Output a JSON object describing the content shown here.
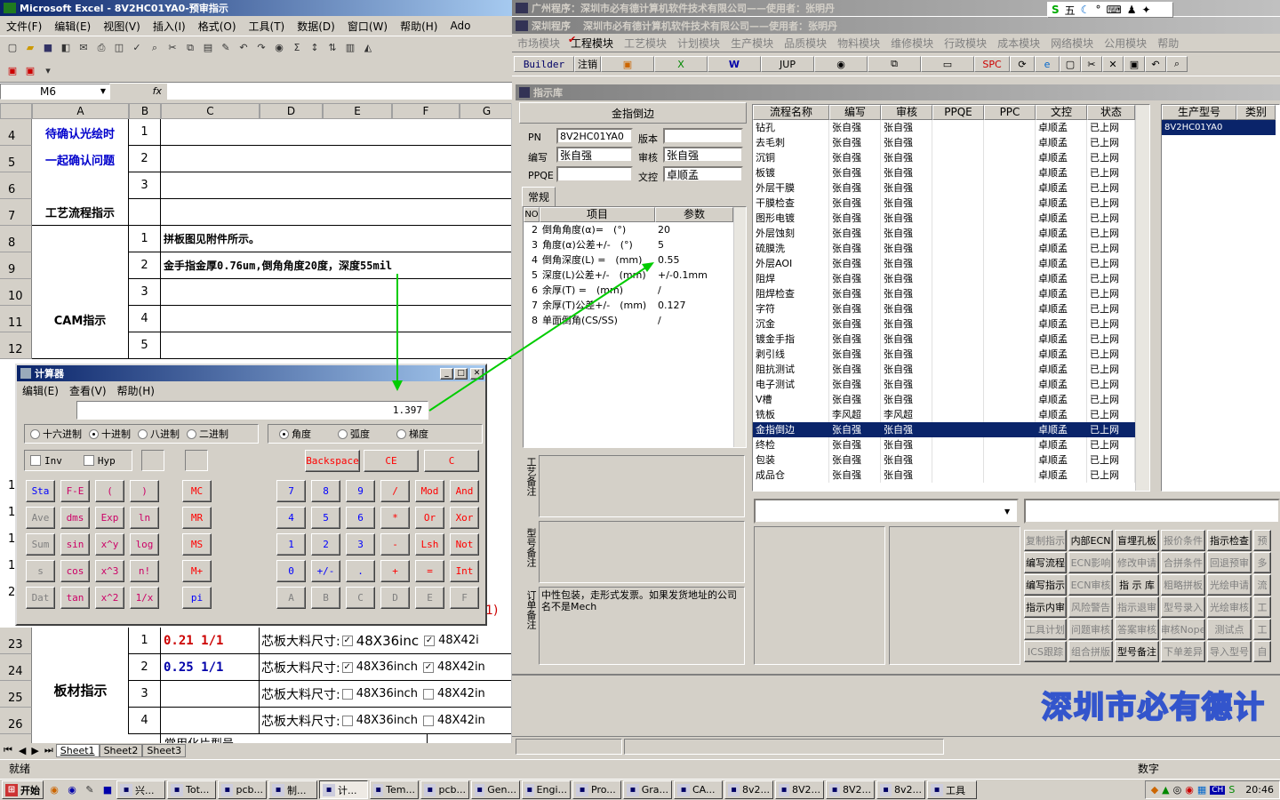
{
  "excel": {
    "title": "Microsoft Excel - 8V2HC01YA0-预审指示",
    "menu": [
      "文件(F)",
      "编辑(E)",
      "视图(V)",
      "插入(I)",
      "格式(O)",
      "工具(T)",
      "数据(D)",
      "窗口(W)",
      "帮助(H)",
      "Ado"
    ],
    "namebox": "M6",
    "fx": "fx",
    "columns": [
      "A",
      "B",
      "C",
      "D",
      "E",
      "F",
      "G"
    ],
    "rows_top": [
      {
        "n": "4",
        "a": "待确认光绘时",
        "b": "1",
        "c": ""
      },
      {
        "n": "5",
        "a": "一起确认问题",
        "b": "2",
        "c": ""
      },
      {
        "n": "6",
        "a": "",
        "b": "3",
        "c": ""
      },
      {
        "n": "7",
        "a": "工艺流程指示",
        "b": "",
        "c": ""
      },
      {
        "n": "8",
        "a": "",
        "b": "1",
        "c": "拼板图见附件所示。"
      },
      {
        "n": "9",
        "a": "",
        "b": "2",
        "c": "金手指金厚0.76um,倒角角度20度，深度55mil"
      },
      {
        "n": "10",
        "a": "",
        "b": "3",
        "c": ""
      },
      {
        "n": "11",
        "a": "CAM指示",
        "b": "4",
        "c": ""
      },
      {
        "n": "12",
        "a": "",
        "b": "5",
        "c": ""
      }
    ],
    "side_row_nums": [
      "1",
      "1",
      "1",
      "1",
      "2"
    ],
    "side_text": "1)",
    "rows_bottom": [
      {
        "n": "23",
        "b": "1",
        "c": "0.21 1/1",
        "d": "芯板大料尺寸:",
        "e": "48X36inc",
        "f": "48X42i"
      },
      {
        "n": "24",
        "b": "2",
        "c": "0.25 1/1",
        "d": "芯板大料尺寸:",
        "e": "48X36inch",
        "f": "48X42in"
      },
      {
        "n": "25",
        "b": "3",
        "c": "",
        "d": "芯板大料尺寸:",
        "e": "48X36inch",
        "f": "48X42in"
      },
      {
        "n": "26",
        "b": "4",
        "c": "",
        "d": "芯板大料尺寸:",
        "e": "48X36inch",
        "f": "48X42in"
      }
    ],
    "cut_row": "常用化片型号",
    "banding_label": "板材指示",
    "sheets": [
      "Sheet1",
      "Sheet2",
      "Sheet3"
    ],
    "status": "就绪"
  },
  "erp": {
    "title": "广州程序：深圳市必有德计算机软件技术有限公司——使用者：张明丹",
    "title2": "深圳程序",
    "title2b": "深圳市必有德计算机软件技术有限公司——使用者：张明丹",
    "menu": [
      "市场模块",
      "工程模块",
      "工艺模块",
      "计划模块",
      "生产模块",
      "品质模块",
      "物料模块",
      "维修模块",
      "行政模块",
      "成本模块",
      "网络模块",
      "公用模块",
      "帮助"
    ],
    "toolbar": [
      "Builder",
      "注销",
      "JUP",
      "SPC"
    ],
    "panel_title": "指示库",
    "subtitle": "金指倒边",
    "form": {
      "pn_label": "PN",
      "pn": "8V2HC01YA0",
      "ver_label": "版本",
      "ver": "",
      "writer_label": "编写",
      "writer": "张自强",
      "audit_label": "审核",
      "audit": "张自强",
      "ppqe_label": "PPQE",
      "ppqe": "",
      "doc_label": "文控",
      "doc": "卓顺孟"
    },
    "tab": "常规",
    "params_headers": [
      "NO",
      "项目",
      "参数"
    ],
    "params": [
      {
        "no": "2",
        "item": "倒角角度(α)=　(°)",
        "val": "20"
      },
      {
        "no": "3",
        "item": "角度(α)公差+/-　(°)",
        "val": "5"
      },
      {
        "no": "4",
        "item": "倒角深度(L) =　(mm)",
        "val": "0.55"
      },
      {
        "no": "5",
        "item": "深度(L)公差+/-　(mm)",
        "val": "+/-0.1mm"
      },
      {
        "no": "6",
        "item": "余厚(T) =　(mm)",
        "val": "/"
      },
      {
        "no": "7",
        "item": "余厚(T)公差+/-　(mm)",
        "val": "0.127"
      },
      {
        "no": "8",
        "item": "单面倒角(CS/SS)",
        "val": "/"
      }
    ],
    "notes": {
      "craft": "工艺备注",
      "model": "型号备注",
      "order": "订单备注",
      "order_text": "中性包装，走形式发票。如果发货地址的公司名不是Mech"
    },
    "flow_headers": [
      "流程名称",
      "编写",
      "审核",
      "PPQE",
      "PPC",
      "文控",
      "状态"
    ],
    "flow": [
      [
        "钻孔",
        "张自强",
        "张自强",
        "",
        "",
        "卓顺孟",
        "已上网"
      ],
      [
        "去毛刺",
        "张自强",
        "张自强",
        "",
        "",
        "卓顺孟",
        "已上网"
      ],
      [
        "沉铜",
        "张自强",
        "张自强",
        "",
        "",
        "卓顺孟",
        "已上网"
      ],
      [
        "板镀",
        "张自强",
        "张自强",
        "",
        "",
        "卓顺孟",
        "已上网"
      ],
      [
        "外层干膜",
        "张自强",
        "张自强",
        "",
        "",
        "卓顺孟",
        "已上网"
      ],
      [
        "干膜检查",
        "张自强",
        "张自强",
        "",
        "",
        "卓顺孟",
        "已上网"
      ],
      [
        "图形电镀",
        "张自强",
        "张自强",
        "",
        "",
        "卓顺孟",
        "已上网"
      ],
      [
        "外层蚀刻",
        "张自强",
        "张自强",
        "",
        "",
        "卓顺孟",
        "已上网"
      ],
      [
        "硫膜洗",
        "张自强",
        "张自强",
        "",
        "",
        "卓顺孟",
        "已上网"
      ],
      [
        "外层AOI",
        "张自强",
        "张自强",
        "",
        "",
        "卓顺孟",
        "已上网"
      ],
      [
        "阻焊",
        "张自强",
        "张自强",
        "",
        "",
        "卓顺孟",
        "已上网"
      ],
      [
        "阻焊检查",
        "张自强",
        "张自强",
        "",
        "",
        "卓顺孟",
        "已上网"
      ],
      [
        "字符",
        "张自强",
        "张自强",
        "",
        "",
        "卓顺孟",
        "已上网"
      ],
      [
        "沉金",
        "张自强",
        "张自强",
        "",
        "",
        "卓顺孟",
        "已上网"
      ],
      [
        "镀金手指",
        "张自强",
        "张自强",
        "",
        "",
        "卓顺孟",
        "已上网"
      ],
      [
        "剥引线",
        "张自强",
        "张自强",
        "",
        "",
        "卓顺孟",
        "已上网"
      ],
      [
        "阻抗测试",
        "张自强",
        "张自强",
        "",
        "",
        "卓顺孟",
        "已上网"
      ],
      [
        "电子测试",
        "张自强",
        "张自强",
        "",
        "",
        "卓顺孟",
        "已上网"
      ],
      [
        "V槽",
        "张自强",
        "张自强",
        "",
        "",
        "卓顺孟",
        "已上网"
      ],
      [
        "铣板",
        "李风超",
        "李风超",
        "",
        "",
        "卓顺孟",
        "已上网"
      ],
      [
        "金指倒边",
        "张自强",
        "张自强",
        "",
        "",
        "卓顺孟",
        "已上网"
      ],
      [
        "终检",
        "张自强",
        "张自强",
        "",
        "",
        "卓顺孟",
        "已上网"
      ],
      [
        "包装",
        "张自强",
        "张自强",
        "",
        "",
        "卓顺孟",
        "已上网"
      ],
      [
        "成品仓",
        "张自强",
        "张自强",
        "",
        "",
        "卓顺孟",
        "已上网"
      ]
    ],
    "selected_flow": 20,
    "model_headers": [
      "生产型号",
      "类别"
    ],
    "model_rows": [
      [
        "8V2HC01YA0",
        ""
      ]
    ],
    "action_buttons": [
      [
        "复制指示",
        "内部ECN",
        "盲埋孔板",
        "报价条件",
        "指示检查",
        "预"
      ],
      [
        "编写流程",
        "ECN影响",
        "修改申请",
        "合拼条件",
        "回退预审",
        "多"
      ],
      [
        "编写指示",
        "ECN审核",
        "指 示 库",
        "粗略拼板",
        "光绘申请",
        "流"
      ],
      [
        "指示内审",
        "风险警告",
        "指示退审",
        "型号录入",
        "光绘审核",
        "工"
      ],
      [
        "工具计划",
        "问题审核",
        "答案审核",
        "审核Nope",
        "测试点",
        "工"
      ],
      [
        "ICS跟踪",
        "组合拼版",
        "型号备注",
        "下单差异",
        "导入型号",
        "自"
      ]
    ],
    "action_enabled": [
      [
        false,
        true,
        true,
        false,
        true,
        false
      ],
      [
        true,
        false,
        false,
        false,
        false,
        false
      ],
      [
        true,
        false,
        true,
        false,
        false,
        false
      ],
      [
        true,
        false,
        false,
        false,
        false,
        false
      ],
      [
        false,
        false,
        false,
        false,
        false,
        false
      ],
      [
        false,
        false,
        true,
        false,
        false,
        false
      ]
    ],
    "brand": "深圳市必有德计",
    "status_right": "数字"
  },
  "calc": {
    "title": "计算器",
    "menu": [
      "编辑(E)",
      "查看(V)",
      "帮助(H)"
    ],
    "display": "1.397",
    "bases": [
      "十六进制",
      "十进制",
      "八进制",
      "二进制"
    ],
    "base_selected": 1,
    "angles": [
      "角度",
      "弧度",
      "梯度"
    ],
    "angle_selected": 0,
    "inv": "Inv",
    "hyp": "Hyp",
    "backspace": "Backspace",
    "ce": "CE",
    "c": "C",
    "sci": [
      [
        "Sta",
        "F-E",
        "(",
        ")"
      ],
      [
        "Ave",
        "dms",
        "Exp",
        "ln"
      ],
      [
        "Sum",
        "sin",
        "x^y",
        "log"
      ],
      [
        "s",
        "cos",
        "x^3",
        "n!"
      ],
      [
        "Dat",
        "tan",
        "x^2",
        "1/x"
      ]
    ],
    "mem": [
      "MC",
      "MR",
      "MS",
      "M+",
      "pi"
    ],
    "num": [
      [
        "7",
        "8",
        "9",
        "/",
        "Mod",
        "And"
      ],
      [
        "4",
        "5",
        "6",
        "*",
        "Or",
        "Xor"
      ],
      [
        "1",
        "2",
        "3",
        "-",
        "Lsh",
        "Not"
      ],
      [
        "0",
        "+/-",
        ".",
        "+",
        "=",
        "Int"
      ],
      [
        "A",
        "B",
        "C",
        "D",
        "E",
        "F"
      ]
    ]
  },
  "taskbar": {
    "start": "开始",
    "tasks": [
      "兴...",
      "Tot...",
      "pcb...",
      "制...",
      "计...",
      "Tem...",
      "pcb...",
      "Gen...",
      "Engi...",
      "Pro...",
      "Gra...",
      "CA...",
      "8v2...",
      "8V2...",
      "8V2...",
      "8v2...",
      "工具"
    ],
    "active_task": 4,
    "time": "20:46",
    "ime": "五"
  },
  "colors": {
    "selection": "#0a246a",
    "arrow": "#00cc00",
    "brand": "#3355cc",
    "titlebar": "#0a246a"
  }
}
